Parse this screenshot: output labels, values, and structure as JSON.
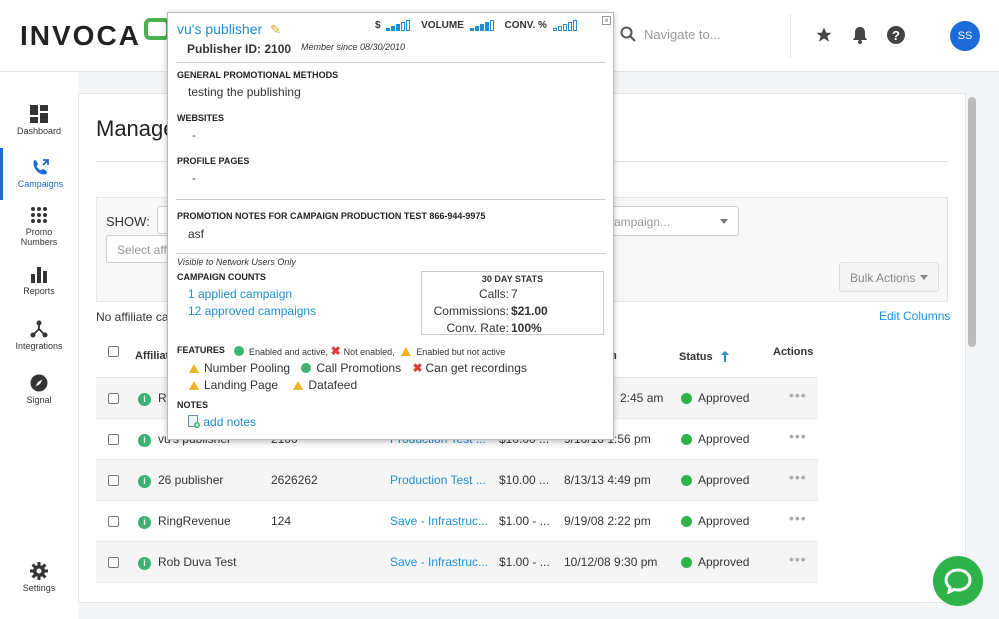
{
  "topbar": {
    "logo": "INVOCA",
    "search_placeholder": "Navigate to...",
    "avatar_initials": "SS"
  },
  "sidebar": {
    "items": [
      {
        "label": "Dashboard",
        "icon": "dashboard-icon"
      },
      {
        "label": "Campaigns",
        "icon": "campaigns-icon",
        "active": true
      },
      {
        "label": "Promo Numbers",
        "icon": "promo-numbers-icon"
      },
      {
        "label": "Reports",
        "icon": "reports-icon"
      },
      {
        "label": "Integrations",
        "icon": "integrations-icon"
      },
      {
        "label": "Signal",
        "icon": "signal-icon"
      },
      {
        "label": "Settings",
        "icon": "settings-icon"
      }
    ]
  },
  "main": {
    "title": "Manage",
    "show_label": "SHOW:",
    "select_affiliate_placeholder": "Select affi",
    "campaign_placeholder": "campaign...",
    "bulk_actions": "Bulk Actions",
    "no_affiliate_text": "No affiliate ca",
    "edit_columns": "Edit Columns",
    "table": {
      "headers": {
        "affiliate": "Affiliat",
        "m": "m",
        "status": "Status",
        "actions": "Actions"
      },
      "rows": [
        {
          "name": "Ri",
          "id": "",
          "campaign": "",
          "payout": "",
          "date": "2:45 am",
          "status": "Approved"
        },
        {
          "name": "vu's publisher",
          "id": "2100",
          "campaign": "Production Test ...",
          "payout": "$10.00 ...",
          "date": "9/10/10 1:56 pm",
          "status": "Approved"
        },
        {
          "name": "26 publisher",
          "id": "2626262",
          "campaign": "Production Test ...",
          "payout": "$10.00 ...",
          "date": "8/13/13 4:49 pm",
          "status": "Approved"
        },
        {
          "name": "RingRevenue",
          "id": "124",
          "campaign": "Save - Infrastruc...",
          "payout": "$1.00 - ...",
          "date": "9/19/08 2:22 pm",
          "status": "Approved"
        },
        {
          "name": "Rob Duva Test",
          "id": "",
          "campaign": "Save - Infrastruc...",
          "payout": "$1.00 - ...",
          "date": "10/12/08 9:30 pm",
          "status": "Approved"
        }
      ]
    }
  },
  "popup": {
    "publisher_name": "vu's publisher",
    "publisher_id_label": "Publisher ID: 2100",
    "member_since": "Member since 08/30/2010",
    "metrics": {
      "dollar": "$",
      "volume": "VOLUME",
      "conv": "CONV. %"
    },
    "metric_levels": {
      "dollar": 3,
      "volume": 4,
      "conv": 0
    },
    "general_promo_title": "GENERAL PROMOTIONAL METHODS",
    "general_promo_value": "testing the publishing",
    "websites_title": "WEBSITES",
    "websites_value": "-",
    "profile_pages_title": "PROFILE PAGES",
    "profile_pages_value": "-",
    "promo_notes_title": "PROMOTION NOTES FOR CAMPAIGN PRODUCTION TEST 866-944-9975",
    "promo_notes_value": "asf",
    "visible_note": "Visible to Network Users Only",
    "campaign_counts_title": "CAMPAIGN COUNTS",
    "applied_campaign": "1 applied campaign",
    "approved_campaigns": "12 approved campaigns",
    "stats_title": "30 DAY STATS",
    "calls_label": "Calls:",
    "calls_value": "7",
    "commissions_label": "Commissions:",
    "commissions_value": "$21.00",
    "conv_rate_label": "Conv. Rate:",
    "conv_rate_value": "100%",
    "features_title": "FEATURES",
    "legend_enabled": "Enabled and active,",
    "legend_not_enabled": "Not enabled,",
    "legend_inactive": "Enabled but not active",
    "feature_number_pooling": "Number Pooling",
    "feature_call_promotions": "Call Promotions",
    "feature_can_get_recordings": "Can get recordings",
    "feature_landing_page": "Landing Page",
    "feature_datafeed": "Datafeed",
    "notes_title": "NOTES",
    "add_notes": "add notes"
  },
  "colors": {
    "accent": "#1d6ad9",
    "link": "#1d8fd6",
    "success": "#2eb24a",
    "warning": "#f0b323"
  }
}
